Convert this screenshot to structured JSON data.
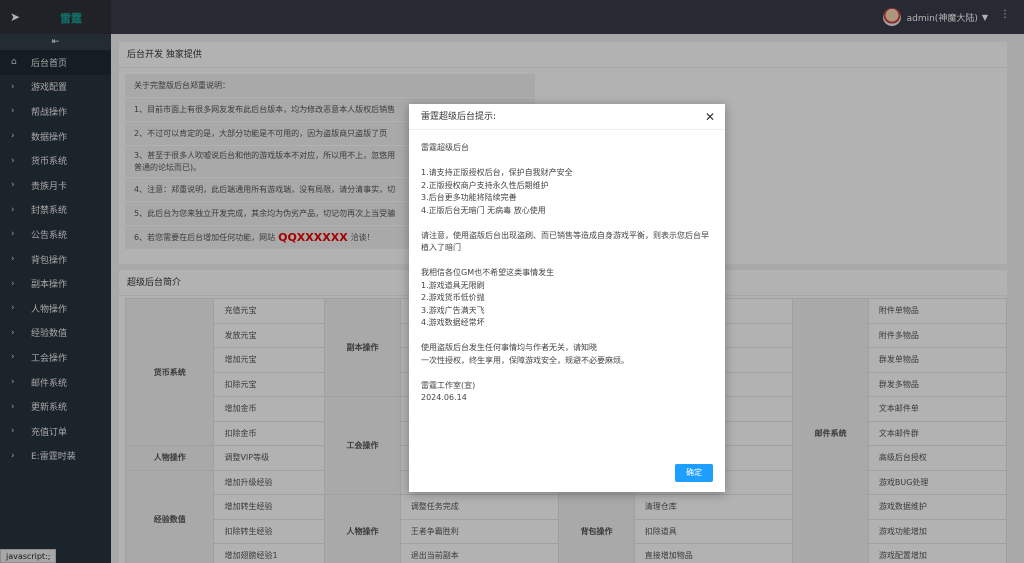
{
  "header": {
    "site_title": "雷霆",
    "user_label": "admin(神魔大陆)"
  },
  "sidebar": {
    "items": [
      {
        "label": "后台首页",
        "icon": "home-icon"
      },
      {
        "label": "游戏配置",
        "icon": "chevron-right-icon"
      },
      {
        "label": "帮战操作",
        "icon": "chevron-right-icon"
      },
      {
        "label": "数据操作",
        "icon": "chevron-right-icon"
      },
      {
        "label": "货币系统",
        "icon": "chevron-right-icon"
      },
      {
        "label": "贵族月卡",
        "icon": "chevron-right-icon"
      },
      {
        "label": "封禁系统",
        "icon": "chevron-right-icon"
      },
      {
        "label": "公告系统",
        "icon": "chevron-right-icon"
      },
      {
        "label": "背包操作",
        "icon": "chevron-right-icon"
      },
      {
        "label": "副本操作",
        "icon": "chevron-right-icon"
      },
      {
        "label": "人物操作",
        "icon": "chevron-right-icon"
      },
      {
        "label": "经验数值",
        "icon": "chevron-right-icon"
      },
      {
        "label": "工会操作",
        "icon": "chevron-right-icon"
      },
      {
        "label": "邮件系统",
        "icon": "chevron-right-icon"
      },
      {
        "label": "更新系统",
        "icon": "chevron-right-icon"
      },
      {
        "label": "充值订单",
        "icon": "chevron-right-icon"
      },
      {
        "label": "E:雷霆时装",
        "icon": "chevron-right-icon"
      }
    ],
    "status_tip": "javascript:;"
  },
  "notice": {
    "title": "后台开发 独家提供",
    "rows": [
      "关于完整版后台郑重说明：",
      "1、目前市面上有很多网友发布此后台版本，均为修改恶意本人版权后销售",
      "2、不过可以肯定的是，大部分功能是不可用的，因为盗版商只盗版了页",
      "3、甚至于很多人吹嘘说后台和他的游戏版本不对应，所以用不上，忽悠用",
      "普通的论坛而已)。",
      "4、注意：郑重说明，此后端通用所有游戏端，没有局限，请分清事实，切",
      "5、此后台为您来独立开发完成，其余均为伪劣产品，切记勿再次上当受骗",
      "6、若您需要在后台增加任何功能，网站"
    ],
    "qq": "QQXXXXXX",
    "contact_suffix": "洽谈！"
  },
  "intro": {
    "title": "超级后台简介",
    "col1_groups": [
      "货币系统",
      "人物操作",
      "经验数值"
    ],
    "col1_items": [
      "充值元宝",
      "发放元宝",
      "增加元宝",
      "扣除元宝",
      "增加金币",
      "扣除金币",
      "调整VIP等级",
      "增加升级经验",
      "增加转生经验",
      "扣除转生经验",
      "增加翅膀经验1"
    ],
    "col2_groups": [
      "副本操作",
      "工会操作",
      "人物操作"
    ],
    "col3_items": [
      "调整任务完成",
      "王者争霸胜利",
      "退出当前副本"
    ],
    "col4_groups": [
      "背包操作"
    ],
    "col5_items": [
      "清理仓库",
      "扣除道具",
      "直接增加物品"
    ],
    "col6_groups": [
      "邮件系统"
    ],
    "col7_items": [
      "附件单物品",
      "附件多物品",
      "群发单物品",
      "群发多物品",
      "文本邮件单",
      "文本邮件群",
      "高级后台授权",
      "游戏BUG处理",
      "游戏数据维护",
      "游戏功能增加",
      "游戏配置增加"
    ]
  },
  "modal": {
    "title": "雷霆超级后台提示:",
    "lines": [
      "雷霆超级后台",
      "",
      "1.请支持正版授权后台，保护自我财产安全",
      "2.正版授权商户支持永久性后期维护",
      "3.后台更多功能将陆续完善",
      "4.正版后台无暗门 无病毒 放心使用",
      "",
      "请注意，使用盗版后台出现盗刷、而已销售等造成自身游戏平衡，则表示您后台早植入了暗门",
      "",
      "我相信各位GM也不希望这类事情发生",
      "1.游戏道具无限刷",
      "2.游戏货币低价抛",
      "3.游戏广告满天飞",
      "4.游戏数据经常坏",
      "",
      "使用盗版后台发生任何事情均与作者无关，请知晓",
      "一次性授权，终生享用，保障游戏安全，规避不必要麻烦。",
      "",
      "雷霆工作室(宣)",
      "2024.06.14"
    ],
    "ok_label": "确定"
  }
}
